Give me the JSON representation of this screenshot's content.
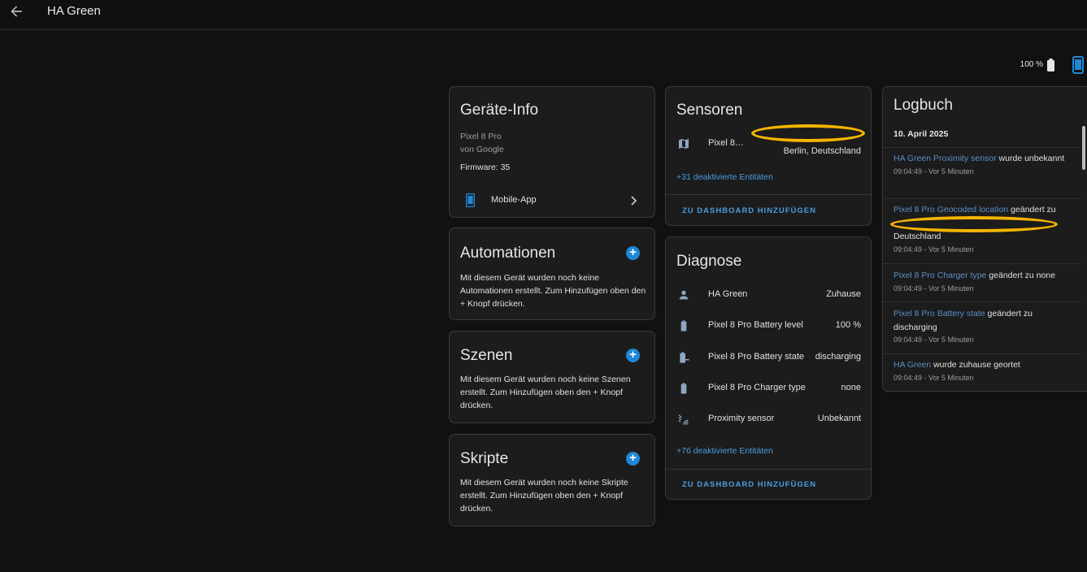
{
  "header": {
    "title": "HA Green",
    "back_icon": "arrow-left-icon"
  },
  "status": {
    "battery_pct": "100 %",
    "battery_icon": "battery-icon",
    "device_icon": "cellphone-icon"
  },
  "device_info": {
    "title": "Geräte-Info",
    "model": "Pixel 8 Pro",
    "manufacturer": "von Google",
    "firmware": "Firmware: 35",
    "integration": "Mobile-App"
  },
  "automations": {
    "title": "Automationen",
    "text": "Mit diesem Gerät wurden noch keine Automationen erstellt. Zum Hinzufügen oben den + Knopf drücken."
  },
  "scenes": {
    "title": "Szenen",
    "text": "Mit diesem Gerät wurden noch keine Szenen erstellt. Zum Hinzufügen oben den + Knopf drücken."
  },
  "scripts": {
    "title": "Skripte",
    "text": "Mit diesem Gerät wurden noch keine Skripte erstellt. Zum Hinzufügen oben den + Knopf drücken."
  },
  "sensors": {
    "title": "Sensoren",
    "rows": [
      {
        "name": "Pixel 8…",
        "value": "Berlin, Deutschland",
        "icon": "map-icon"
      }
    ],
    "disabled": "+31 deaktivierte Entitäten",
    "add_button": "ZU DASHBOARD HINZUFÜGEN"
  },
  "diagnostics": {
    "title": "Diagnose",
    "rows": [
      {
        "name": "HA Green",
        "value": "Zuhause",
        "icon": "person-icon"
      },
      {
        "name": "Pixel 8 Pro Battery level",
        "value": "100 %",
        "icon": "battery-icon"
      },
      {
        "name": "Pixel 8 Pro Battery state",
        "value": "discharging",
        "icon": "battery-minus-icon"
      },
      {
        "name": "Pixel 8 Pro Charger type",
        "value": "none",
        "icon": "battery-icon"
      },
      {
        "name": "Proximity sensor",
        "value": "Unbekannt",
        "icon": "proximity-icon"
      }
    ],
    "disabled": "+76 deaktivierte Entitäten",
    "add_button": "ZU DASHBOARD HINZUFÜGEN"
  },
  "logbook": {
    "title": "Logbuch",
    "date": "10. April 2025",
    "entries": [
      {
        "entity": "HA Green Proximity sensor",
        "message": " wurde unbekannt",
        "time": "09:04:49 - Vor 5 Minuten"
      },
      {
        "entity": "Pixel 8 Pro Geocoded location",
        "message": " geändert zu",
        "message2": "Deutschland",
        "time": "09:04:49 - Vor 5 Minuten"
      },
      {
        "entity": "Pixel 8 Pro Charger type",
        "message": " geändert zu none",
        "time": "09:04:49 - Vor 5 Minuten"
      },
      {
        "entity": "Pixel 8 Pro Battery state",
        "message": " geändert zu discharging",
        "time": "09:04:49 - Vor 5 Minuten"
      },
      {
        "entity": "HA Green",
        "message": " wurde zuhause geortet",
        "time": "09:04:49 - Vor 5 Minuten"
      }
    ]
  },
  "colors": {
    "accent": "#4a9de0",
    "highlight": "#f4b400",
    "card": "#1c1c1c",
    "background": "#111111"
  }
}
